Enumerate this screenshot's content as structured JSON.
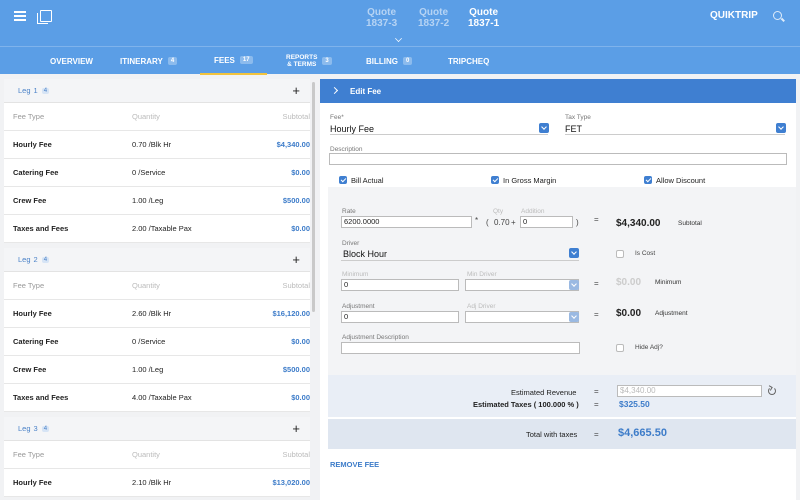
{
  "header": {
    "quotes": [
      {
        "label": "Quote",
        "number": "1837-3"
      },
      {
        "label": "Quote",
        "number": "1837-2"
      },
      {
        "label": "Quote",
        "number": "1837-1"
      }
    ],
    "brand": "QUIKTRIP"
  },
  "tabs": [
    {
      "label": "OVERVIEW",
      "count": ""
    },
    {
      "label": "ITINERARY",
      "count": "4"
    },
    {
      "label": "FEES",
      "count": "17"
    },
    {
      "label_line1": "REPORTS",
      "label_line2": "& TERMS",
      "count": "3"
    },
    {
      "label": "BILLING",
      "count": "0"
    },
    {
      "label": "TRIPCHEQ",
      "count": ""
    }
  ],
  "legs": [
    {
      "title": "Leg",
      "number": "1",
      "badge": "4",
      "headers": {
        "type": "Fee Type",
        "quantity": "Quantity",
        "subtotal": "Subtotal"
      },
      "rows": [
        {
          "type": "Hourly Fee",
          "quantity": "0.70 /Blk Hr",
          "subtotal": "$4,340.00"
        },
        {
          "type": "Catering Fee",
          "quantity": "0 /Service",
          "subtotal": "$0.00"
        },
        {
          "type": "Crew Fee",
          "quantity": "1.00 /Leg",
          "subtotal": "$500.00"
        },
        {
          "type": "Taxes and Fees",
          "quantity": "2.00 /Taxable Pax",
          "subtotal": "$0.00"
        }
      ]
    },
    {
      "title": "Leg",
      "number": "2",
      "badge": "4",
      "headers": {
        "type": "Fee Type",
        "quantity": "Quantity",
        "subtotal": "Subtotal"
      },
      "rows": [
        {
          "type": "Hourly Fee",
          "quantity": "2.60 /Blk Hr",
          "subtotal": "$16,120.00"
        },
        {
          "type": "Catering Fee",
          "quantity": "0 /Service",
          "subtotal": "$0.00"
        },
        {
          "type": "Crew Fee",
          "quantity": "1.00 /Leg",
          "subtotal": "$500.00"
        },
        {
          "type": "Taxes and Fees",
          "quantity": "4.00 /Taxable Pax",
          "subtotal": "$0.00"
        }
      ]
    },
    {
      "title": "Leg",
      "number": "3",
      "badge": "4",
      "headers": {
        "type": "Fee Type",
        "quantity": "Quantity",
        "subtotal": "Subtotal"
      },
      "rows": [
        {
          "type": "Hourly Fee",
          "quantity": "2.10 /Blk Hr",
          "subtotal": "$13,020.00"
        }
      ]
    }
  ],
  "edit": {
    "title": "Edit Fee",
    "fee_label": "Fee*",
    "fee_value": "Hourly Fee",
    "tax_type_label": "Tax Type",
    "tax_type_value": "FET",
    "description_label": "Description",
    "description_value": "",
    "bill_actual": "Bill Actual",
    "in_gross_margin": "In Gross Margin",
    "allow_discount": "Allow Discount",
    "rate_label": "Rate",
    "rate_value": "6200.0000",
    "qty_label": "Qty",
    "qty_value": "0.70",
    "addition_label": "Addition",
    "addition_value": "0",
    "subtotal_value": "$4,340.00",
    "subtotal_label": "Subtotal",
    "driver_label": "Driver",
    "driver_value": "Block Hour",
    "is_cost": "Is Cost",
    "minimum_label": "Minimum",
    "minimum_value": "0",
    "min_driver_label": "Min Driver",
    "minimum_result": "$0.00",
    "minimum_side": "Minimum",
    "adjustment_label": "Adjustment",
    "adjustment_value": "0",
    "adj_driver_label": "Adj Driver",
    "adjustment_result": "$0.00",
    "adjustment_side": "Adjustment",
    "adjustment_desc_label": "Adjustment Description",
    "hide_adj": "Hide Adj?",
    "est_revenue_label": "Estimated Revenue",
    "est_revenue_value": "$4,340.00",
    "est_taxes_label": "Estimated Taxes ( 100.000 % )",
    "est_taxes_value": "$325.50",
    "total_label": "Total with taxes",
    "total_value": "$4,665.50",
    "remove_fee": "REMOVE FEE",
    "ops": {
      "times": "*",
      "open_paren": "(",
      "plus": "+",
      "close_paren": ")",
      "equals": "="
    }
  }
}
